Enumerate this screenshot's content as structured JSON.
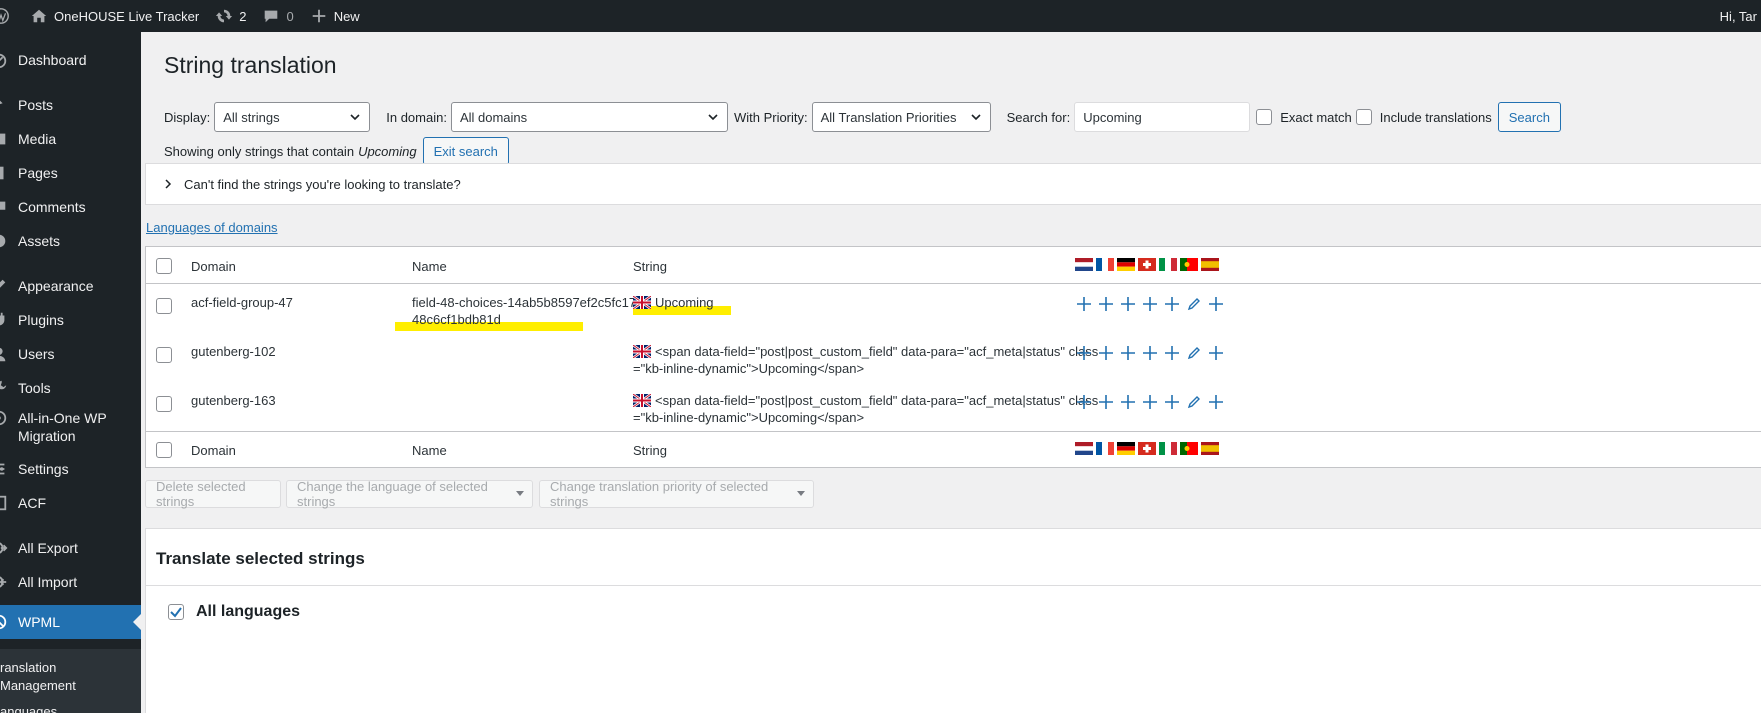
{
  "adminbar": {
    "site_name": "OneHOUSE Live Tracker",
    "updates_count": "2",
    "comments_count": "0",
    "new_label": "New",
    "greeting": "Hi, Tar"
  },
  "sidebar": {
    "items": [
      {
        "label": "Dashboard",
        "icon": "dashboard-icon"
      },
      {
        "label": "Posts",
        "icon": "pin-icon"
      },
      {
        "label": "Media",
        "icon": "media-icon"
      },
      {
        "label": "Pages",
        "icon": "page-icon"
      },
      {
        "label": "Comments",
        "icon": "comment-icon"
      },
      {
        "label": "Assets",
        "icon": "assets-icon"
      },
      {
        "label": "Appearance",
        "icon": "brush-icon"
      },
      {
        "label": "Plugins",
        "icon": "plugin-icon"
      },
      {
        "label": "Users",
        "icon": "users-icon"
      },
      {
        "label": "Tools",
        "icon": "wrench-icon"
      },
      {
        "label_line1": "All-in-One WP",
        "label_line2": "Migration",
        "icon": "migration-icon"
      },
      {
        "label": "Settings",
        "icon": "settings-icon"
      },
      {
        "label": "ACF",
        "icon": "acf-icon"
      },
      {
        "label": "All Export",
        "icon": "export-icon"
      },
      {
        "label": "All Import",
        "icon": "import-icon"
      },
      {
        "label": "WPML",
        "icon": "wpml-icon"
      }
    ],
    "submenu": {
      "item1_line1": "ranslation",
      "item1_line2": "Management",
      "item2": "anguages"
    }
  },
  "page": {
    "title": "String translation"
  },
  "filters": {
    "display_label": "Display:",
    "display_value": "All strings",
    "domain_label": "In domain:",
    "domain_value": "All domains",
    "priority_label": "With Priority:",
    "priority_value": "All Translation Priorities",
    "search_label": "Search for:",
    "search_value": "Upcoming",
    "exact_match_label": "Exact match",
    "include_translations_label": "Include translations",
    "search_button": "Search"
  },
  "showing": {
    "prefix": "Showing only strings that contain",
    "term": "Upcoming",
    "exit_button": "Exit search"
  },
  "collapsible": {
    "text": "Can't find the strings you're looking to translate?"
  },
  "languages_link": "Languages of domains",
  "table": {
    "columns": {
      "domain": "Domain",
      "name": "Name",
      "string": "String"
    },
    "flags": [
      "nl",
      "fr",
      "de",
      "ch",
      "it",
      "pt",
      "es"
    ],
    "rows": [
      {
        "domain": "acf-field-group-47",
        "name_line1": "field-48-choices-14ab5b8597ef2c5fc17",
        "name_line2": "48c6cf1bdb81d",
        "string_line1": "Upcoming",
        "string_line2": ""
      },
      {
        "domain": "gutenberg-102",
        "name_line1": "",
        "name_line2": "",
        "string_line1": "<span data-field=\"post|post_custom_field\" data-para=\"acf_meta|status\" class",
        "string_line2": "=\"kb-inline-dynamic\">Upcoming</span>"
      },
      {
        "domain": "gutenberg-163",
        "name_line1": "",
        "name_line2": "",
        "string_line1": "<span data-field=\"post|post_custom_field\" data-para=\"acf_meta|status\" class",
        "string_line2": "=\"kb-inline-dynamic\">Upcoming</span>"
      }
    ]
  },
  "bulk": {
    "delete": "Delete selected strings",
    "change_language": "Change the language of selected strings",
    "change_priority": "Change translation priority of selected strings"
  },
  "panel": {
    "title": "Translate selected strings",
    "all_languages": "All languages"
  },
  "colors": {
    "admin_dark": "#1d2327",
    "accent": "#2271b1",
    "highlight": "#ffee00"
  }
}
